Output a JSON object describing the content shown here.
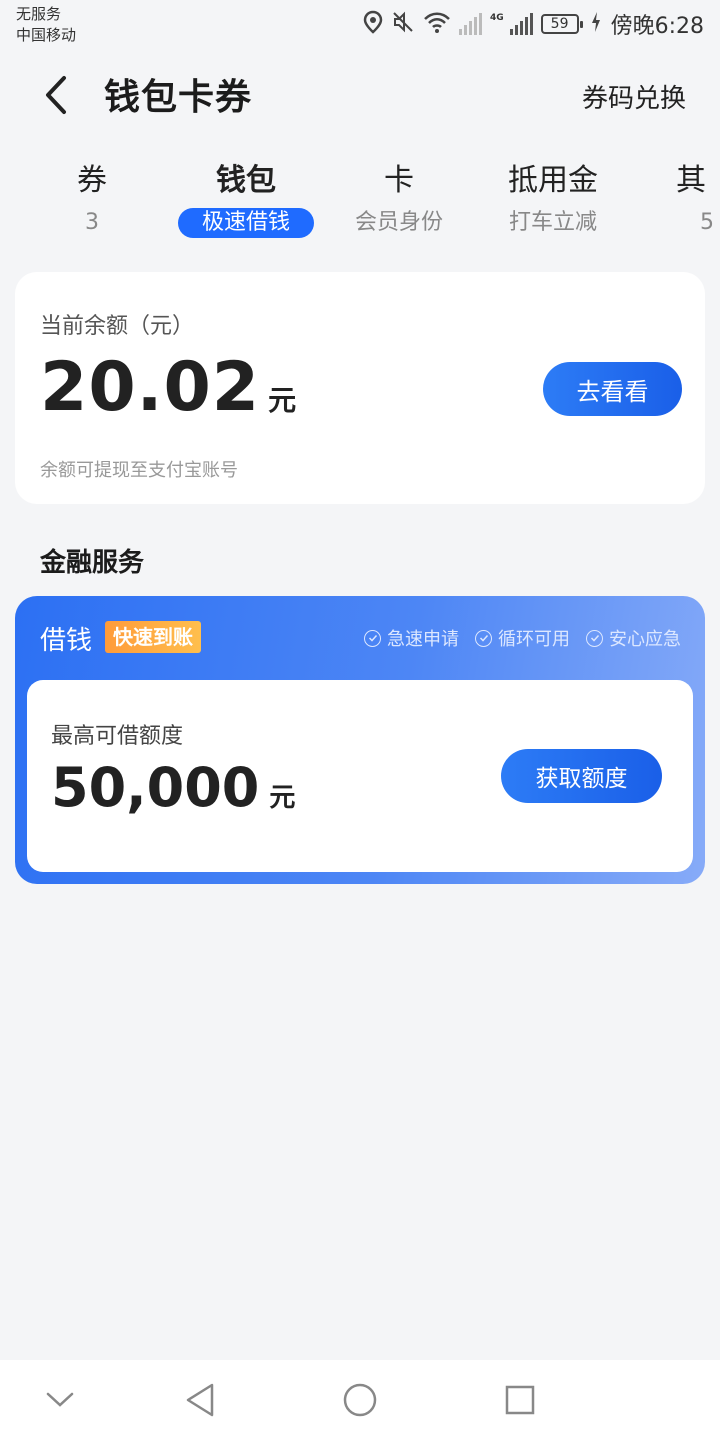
{
  "status_bar": {
    "carrier_line1": "无服务",
    "carrier_line2": "中国移动",
    "network": "4G",
    "battery": "59",
    "time": "傍晚6:28"
  },
  "header": {
    "title": "钱包卡券",
    "redeem_label": "券码兑换"
  },
  "tabs": [
    {
      "label": "券",
      "sub": "3",
      "active": false
    },
    {
      "label": "钱包",
      "sub": "极速借钱",
      "active": true
    },
    {
      "label": "卡",
      "sub": "会员身份",
      "active": false
    },
    {
      "label": "抵用金",
      "sub": "打车立减",
      "active": false
    },
    {
      "label": "其",
      "sub": "5",
      "active": false
    }
  ],
  "balance": {
    "label": "当前余额（元）",
    "value": "20.02",
    "unit": "元",
    "button_label": "去看看",
    "note": "余额可提现至支付宝账号"
  },
  "finance": {
    "section_title": "金融服务",
    "loan_title": "借钱",
    "badge": "快速到账",
    "features": [
      "急速申请",
      "循环可用",
      "安心应急"
    ],
    "limit_label": "最高可借额度",
    "limit_value": "50,000",
    "limit_unit": "元",
    "button_label": "获取额度"
  },
  "colors": {
    "accent": "#1f6bff",
    "badge": "#ff9b3a",
    "page_bg": "#f4f5f7"
  }
}
